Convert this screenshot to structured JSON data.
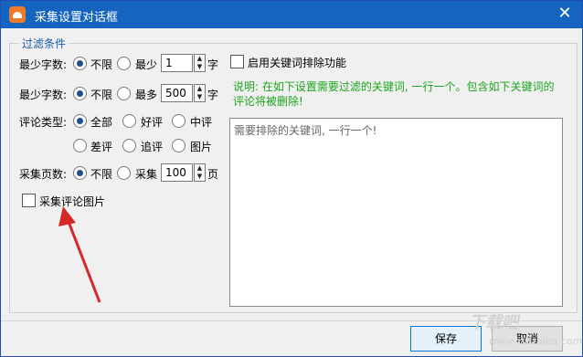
{
  "window": {
    "title": "采集设置对话框",
    "close": "✕"
  },
  "group": {
    "title": "过滤条件"
  },
  "min_words": {
    "label": "最少字数:",
    "unlimited": "不限",
    "at_least": "最少",
    "value": "1",
    "unit": "字"
  },
  "max_words": {
    "label": "最少字数:",
    "unlimited": "不限",
    "at_most": "最多",
    "value": "500",
    "unit": "字"
  },
  "review_type": {
    "label": "评论类型:",
    "options": [
      "全部",
      "好评",
      "中评",
      "差评",
      "追评",
      "图片"
    ],
    "selected": "全部"
  },
  "pages": {
    "label": "采集页数:",
    "unlimited": "不限",
    "collect": "采集",
    "value": "100",
    "unit": "页"
  },
  "collect_images": {
    "label": "采集评论图片",
    "checked": false
  },
  "keyword_filter": {
    "label": "启用关键词排除功能",
    "checked": false
  },
  "note": "说明: 在如下设置需要过滤的关键词, 一行一个。包含如下关键词的评论将被删除!",
  "keywords": {
    "placeholder": "需要排除的关键词, 一行一个!",
    "value": ""
  },
  "buttons": {
    "save": "保存",
    "cancel": "取消"
  },
  "watermark": {
    "logo": "下载吧",
    "url": "www.xiazaiba.com"
  },
  "colors": {
    "titlebar": "#1565c0",
    "accent": "#1b5aa8",
    "note": "#1ca51c",
    "arrow": "#d62828"
  }
}
